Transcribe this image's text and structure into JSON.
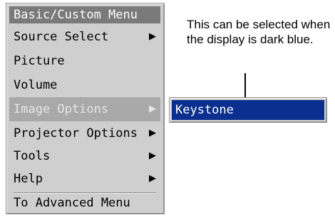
{
  "menu": {
    "title": "Basic/Custom Menu",
    "items": [
      {
        "label": "Source Select",
        "arrow": "▶",
        "highlighted": false
      },
      {
        "label": "Picture",
        "arrow": "",
        "highlighted": false
      },
      {
        "label": "Volume",
        "arrow": "",
        "highlighted": false
      },
      {
        "label": "Image Options",
        "arrow": "▶",
        "highlighted": true
      },
      {
        "label": "Projector Options",
        "arrow": "▶",
        "highlighted": false
      },
      {
        "label": "Tools",
        "arrow": "▶",
        "highlighted": false
      },
      {
        "label": "Help",
        "arrow": "▶",
        "highlighted": false
      }
    ],
    "footer_item": "To Advanced Menu"
  },
  "submenu": {
    "items": [
      {
        "label": "Keystone",
        "selected": true
      }
    ],
    "selected_color": "#0b2f8f"
  },
  "annotation": {
    "text": "This can be selected when the display is dark blue."
  },
  "colors": {
    "menu_bg": "#cfcfcf",
    "title_bg": "#7a7a7a",
    "highlight_bg": "#a9a9a9",
    "selected_bg": "#0b2f8f"
  }
}
